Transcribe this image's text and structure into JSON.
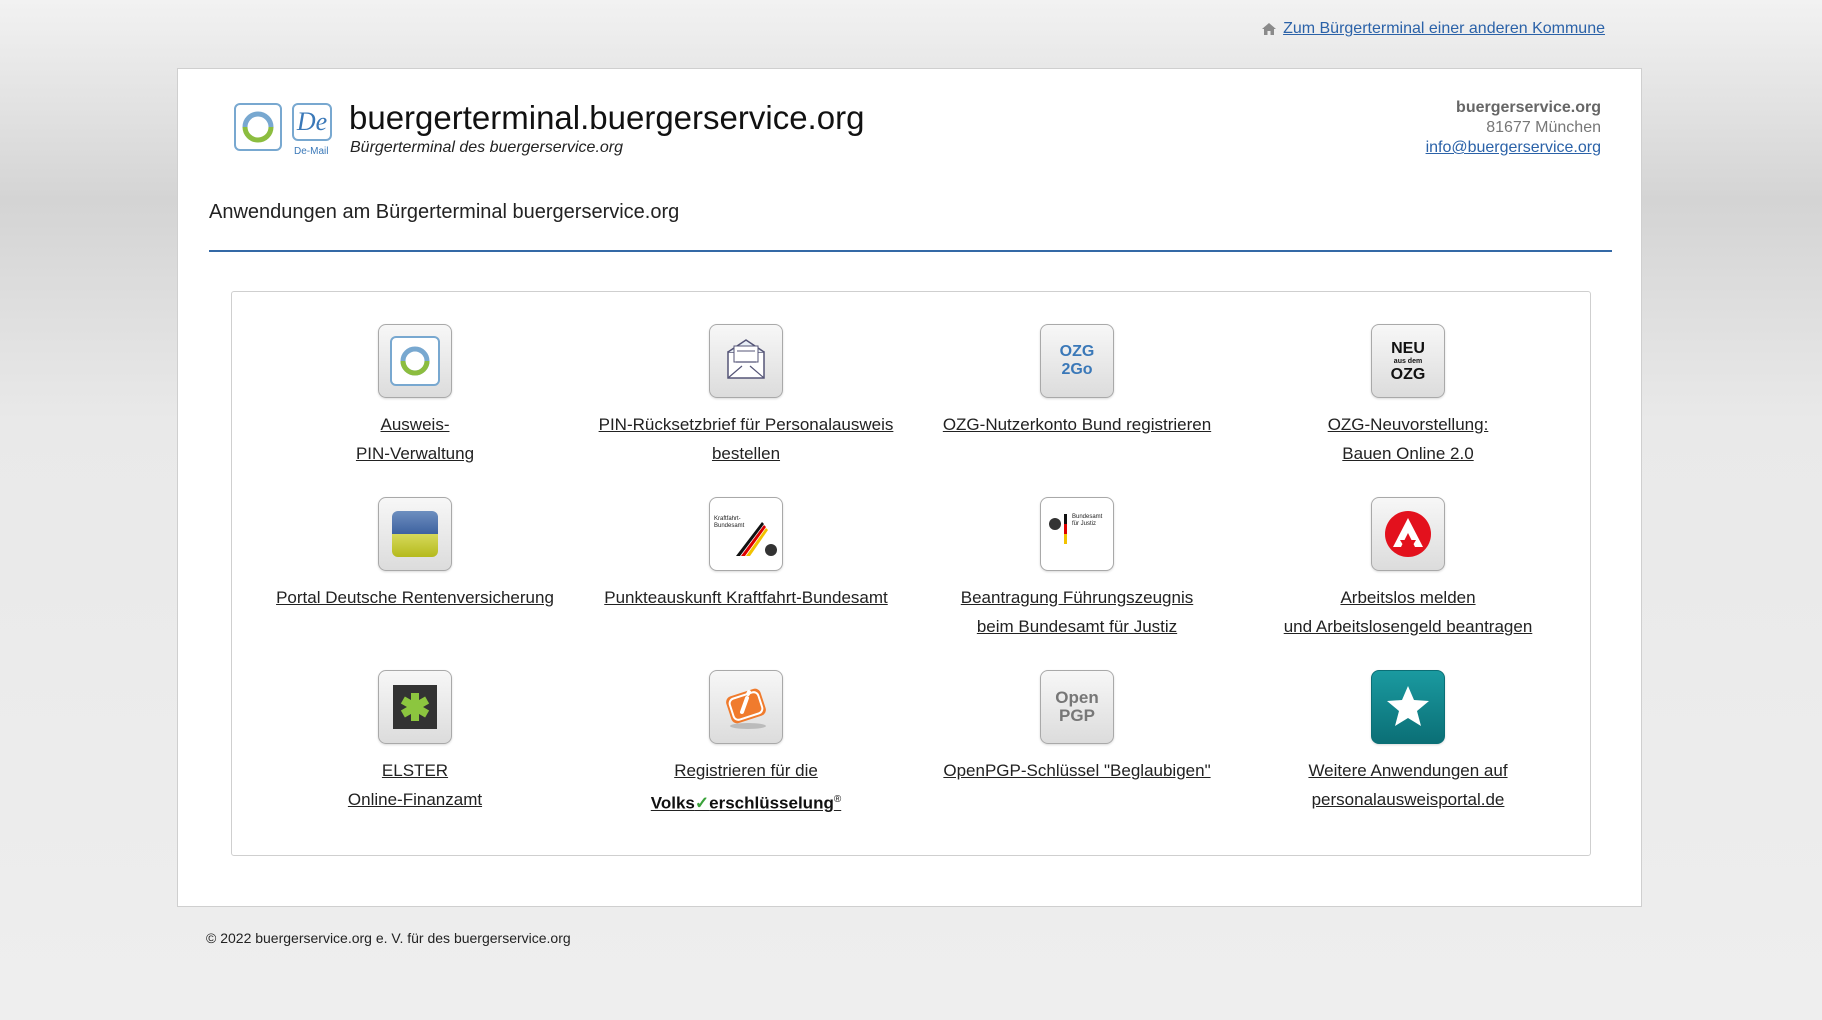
{
  "top_link": "Zum Bürgerterminal einer anderen Kommune",
  "header": {
    "site_title": "buergerterminal.buergerservice.org",
    "subtitle": "Bürgerterminal des buergerservice.org",
    "demail_label": "De-Mail",
    "demail_letters": "De"
  },
  "contact": {
    "org": "buergerservice.org",
    "city": "81677 München",
    "email": "info@buergerservice.org"
  },
  "page_heading": "Anwendungen am Bürgerterminal buergerservice.org",
  "apps": [
    {
      "line1": "Ausweis-",
      "line2": "PIN-Verwaltung",
      "icon": "ausweis-icon"
    },
    {
      "line1": "PIN-Rücksetzbrief für Personalausweis",
      "line2": "bestellen",
      "icon": "letter-icon"
    },
    {
      "line1": "OZG-Nutzerkonto Bund registrieren",
      "line2": "",
      "icon": "ozg2go-icon",
      "icon_text1": "OZG",
      "icon_text2": "2Go"
    },
    {
      "line1": "OZG-Neuvorstellung:",
      "line2": "Bauen Online 2.0",
      "icon": "neu-ozg-icon",
      "icon_text1": "NEU",
      "icon_text2": "aus dem",
      "icon_text3": "OZG"
    },
    {
      "line1": "Portal Deutsche Rentenversicherung",
      "line2": "",
      "icon": "rentenversicherung-icon"
    },
    {
      "line1": "Punkteauskunft Kraftfahrt-Bundesamt",
      "line2": "",
      "icon": "kba-icon",
      "icon_text1": "Kraftfahrt-",
      "icon_text2": "Bundesamt"
    },
    {
      "line1": "Beantragung Führungszeugnis",
      "line2": "beim Bundesamt für Justiz",
      "icon": "bundesamt-justiz-icon",
      "icon_text1": "Bundesamt",
      "icon_text2": "für Justiz"
    },
    {
      "line1": "Arbeitslos melden",
      "line2": "und Arbeitslosengeld beantragen",
      "icon": "arbeitsagentur-icon"
    },
    {
      "line1": "ELSTER",
      "line2": "Online-Finanzamt",
      "icon": "elster-icon"
    },
    {
      "line1": "Registrieren für die",
      "line2_a": "Volks",
      "line2_check": "✓",
      "line2_b": "erschlüsselung",
      "line2_reg": "®",
      "icon": "volksverschluesselung-icon"
    },
    {
      "line1": "OpenPGP-Schlüssel \"Beglaubigen\"",
      "line2": "",
      "icon": "openpgp-icon",
      "icon_text1": "Open",
      "icon_text2": "PGP"
    },
    {
      "line1": "Weitere Anwendungen auf",
      "line2": "personalausweisportal.de",
      "icon": "star-icon"
    }
  ],
  "colors": {
    "link": "#2b62a8",
    "rule": "#3469a6",
    "arbeitsagentur_red": "#e3111d",
    "elster_green": "#8cc63f",
    "star_teal": "#0f7f86",
    "volks_check": "#3aa23a"
  },
  "footer": "© 2022 buergerservice.org e. V. für des buergerservice.org"
}
